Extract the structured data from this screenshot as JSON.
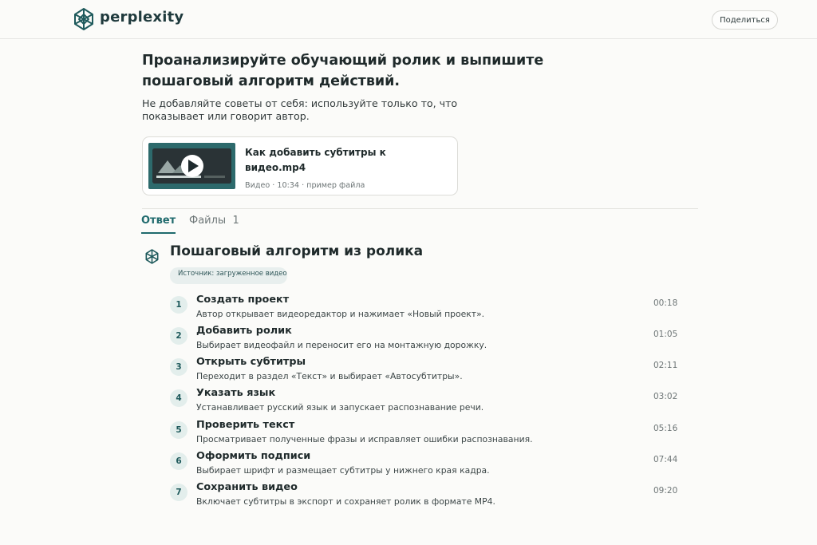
{
  "header": {
    "brand": "perplexity",
    "share_label": "Поделиться"
  },
  "query": {
    "title": "Проанализируйте обучающий ролик и выпишите пошаговый алгоритм действий.",
    "subtitle": "Не добавляйте советы от себя: используйте только то, что показывает или говорит автор."
  },
  "attachment": {
    "name": "Как добавить субтитры к видео.mp4",
    "meta": "Видео · 10:34 · пример файла"
  },
  "tabs": {
    "answer": "Ответ",
    "files": "Файлы  1"
  },
  "answer": {
    "heading": "Пошаговый алгоритм из ролика",
    "source": "Источник: загруженное видео"
  },
  "steps": [
    {
      "num": "1",
      "title": "Создать проект",
      "desc": "Автор открывает видеоредактор и нажимает «Новый проект».",
      "time": "00:18"
    },
    {
      "num": "2",
      "title": "Добавить ролик",
      "desc": "Выбирает видеофайл и переносит его на монтажную дорожку.",
      "time": "01:05"
    },
    {
      "num": "3",
      "title": "Открыть субтитры",
      "desc": "Переходит в раздел «Текст» и выбирает «Автосубтитры».",
      "time": "02:11"
    },
    {
      "num": "4",
      "title": "Указать язык",
      "desc": "Устанавливает русский язык и запускает распознавание речи.",
      "time": "03:02"
    },
    {
      "num": "5",
      "title": "Проверить текст",
      "desc": "Просматривает полученные фразы и исправляет ошибки распознавания.",
      "time": "05:16"
    },
    {
      "num": "6",
      "title": "Оформить подписи",
      "desc": "Выбирает шрифт и размещает субтитры у нижнего края кадра.",
      "time": "07:44"
    },
    {
      "num": "7",
      "title": "Сохранить видео",
      "desc": "Включает субтитры в экспорт и сохраняет ролик в формате MP4.",
      "time": "09:20"
    }
  ],
  "colors": {
    "accent": "#1f6a6d",
    "background": "#fbfbf9"
  }
}
